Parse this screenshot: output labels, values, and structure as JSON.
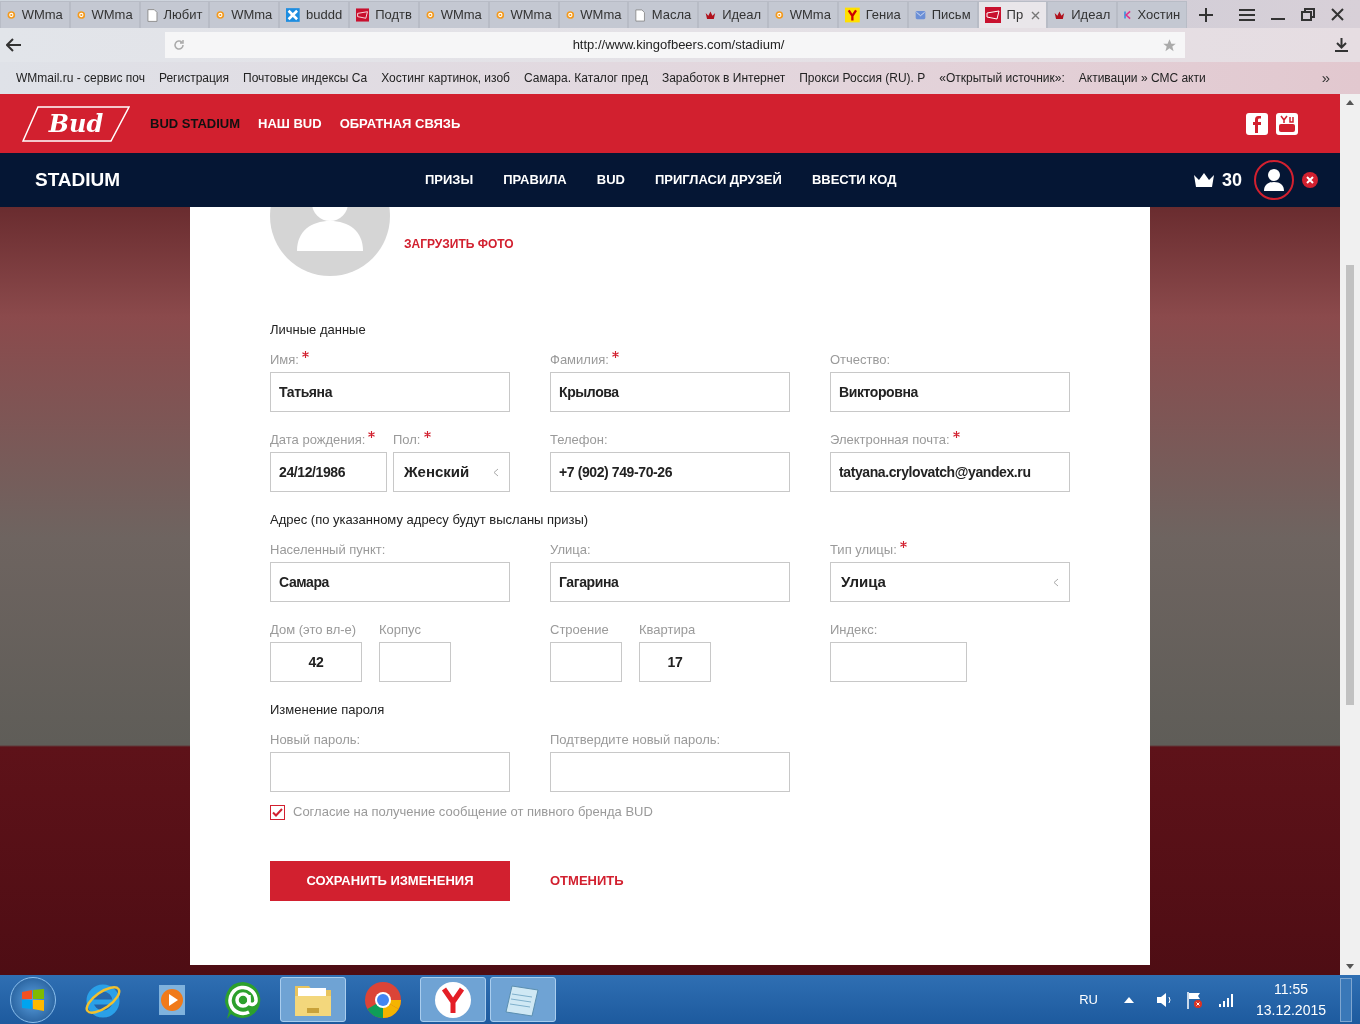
{
  "browser": {
    "tabs": [
      {
        "title": "WMma",
        "kind": "wm",
        "selected": false
      },
      {
        "title": "WMma",
        "kind": "wm",
        "selected": false
      },
      {
        "title": "Любит",
        "kind": "page",
        "selected": false
      },
      {
        "title": "WMma",
        "kind": "wm",
        "selected": false
      },
      {
        "title": "buddd",
        "kind": "x",
        "selected": false
      },
      {
        "title": "Подтв",
        "kind": "bud",
        "selected": false
      },
      {
        "title": "WMma",
        "kind": "wm",
        "selected": false
      },
      {
        "title": "WMma",
        "kind": "wm",
        "selected": false
      },
      {
        "title": "WMma",
        "kind": "wm",
        "selected": false
      },
      {
        "title": "Масла",
        "kind": "page",
        "selected": false
      },
      {
        "title": "Идеал",
        "kind": "crown",
        "selected": false
      },
      {
        "title": "WMma",
        "kind": "wm",
        "selected": false
      },
      {
        "title": "Гениа",
        "kind": "y",
        "selected": false
      },
      {
        "title": "Письм",
        "kind": "mail",
        "selected": false
      },
      {
        "title": "Пр",
        "kind": "bud",
        "selected": true
      },
      {
        "title": "Идеал",
        "kind": "crown",
        "selected": false
      },
      {
        "title": "Хостин",
        "kind": "k",
        "selected": false
      }
    ],
    "address": "http://www.kingofbeers.com/stadium/",
    "bookmarks": [
      "WMmail.ru - сервис поч",
      "Регистрация",
      "Почтовые индексы Са",
      "Хостинг картинок, изоб",
      "Самара. Каталог пред",
      "Заработок в Интернет",
      "Прокси Россия (RU). P",
      "«Открытый источник»:",
      "Активации » СМС акти"
    ],
    "bookmarks_more": "»"
  },
  "site": {
    "logo": "Bud",
    "top_nav": [
      {
        "label": "BUD STADIUM",
        "selected": true
      },
      {
        "label": "НАШ BUD",
        "selected": false
      },
      {
        "label": "ОБРАТНАЯ СВЯЗЬ",
        "selected": false
      }
    ],
    "section_title": "STADIUM",
    "main_nav": [
      "ПРИЗЫ",
      "ПРАВИЛА",
      "BUD",
      "ПРИГЛАСИ ДРУЗЕЙ",
      "ВВЕСТИ КОД"
    ],
    "points": "30"
  },
  "profile": {
    "upload_photo": "ЗАГРУЗИТЬ ФОТО",
    "sections": [
      {
        "title": "Личные данные",
        "rows": [
          [
            [
              {
                "label": "Имя:",
                "required": true,
                "value": "Татьяна",
                "kind": "text"
              }
            ],
            [
              {
                "label": "Фамилия:",
                "required": true,
                "value": "Крылова",
                "kind": "text"
              }
            ],
            [
              {
                "label": "Отчество:",
                "required": false,
                "value": "Викторовна",
                "kind": "text"
              }
            ]
          ],
          [
            [
              {
                "label": "Дата рождения:",
                "required": true,
                "value": "24/12/1986",
                "kind": "text"
              },
              {
                "label": "Пол:",
                "required": true,
                "value": "Женский",
                "kind": "select"
              }
            ],
            [
              {
                "label": "Телефон:",
                "required": false,
                "value": "+7 (902) 749-70-26",
                "kind": "text"
              }
            ],
            [
              {
                "label": "Электронная почта:",
                "required": true,
                "value": "tatyana.crylovatch@yandex.ru",
                "kind": "text"
              }
            ]
          ]
        ]
      },
      {
        "title": "Адрес (по указанному адресу будут высланы призы)",
        "rows": [
          [
            [
              {
                "label": "Населенный пункт:",
                "required": false,
                "value": "Самара",
                "kind": "text"
              }
            ],
            [
              {
                "label": "Улица:",
                "required": false,
                "value": "Гагарина",
                "kind": "text"
              }
            ],
            [
              {
                "label": "Тип улицы:",
                "required": true,
                "value": "Улица",
                "kind": "select"
              }
            ]
          ],
          [
            [
              {
                "label": "Дом (это вл-е)",
                "required": false,
                "value": "42",
                "kind": "short"
              },
              {
                "label": "Корпус",
                "required": false,
                "kind": "short"
              }
            ],
            [
              {
                "label": "Строение",
                "required": false,
                "kind": "short"
              },
              {
                "label": "Квартира",
                "required": false,
                "value": "17",
                "kind": "short"
              }
            ],
            [
              {
                "label": "Индекс:",
                "required": false,
                "kind": "medium"
              }
            ]
          ]
        ]
      },
      {
        "title": "Изменение пароля",
        "rows": [
          [
            [
              {
                "label": "Новый пароль:",
                "required": false,
                "kind": "text"
              }
            ],
            [
              {
                "label": "Подтвердите новый пароль:",
                "required": false,
                "kind": "text"
              }
            ],
            []
          ]
        ]
      }
    ],
    "consent": {
      "label": "Согласие на получение сообщение от пивного бренда BUD",
      "checked": true
    },
    "save": "СОХРАНИТЬ ИЗМЕНЕНИЯ",
    "cancel": "ОТМЕНИТЬ"
  },
  "taskbar": {
    "apps": [
      {
        "kind": "ie",
        "active": false
      },
      {
        "kind": "player",
        "active": false
      },
      {
        "kind": "at",
        "active": false
      },
      {
        "kind": "folder",
        "active": true
      },
      {
        "kind": "chrome",
        "active": false
      },
      {
        "kind": "yandex",
        "active": true
      },
      {
        "kind": "notepad",
        "active": true
      }
    ],
    "language": "RU",
    "time": "11:55",
    "date": "13.12.2015"
  }
}
